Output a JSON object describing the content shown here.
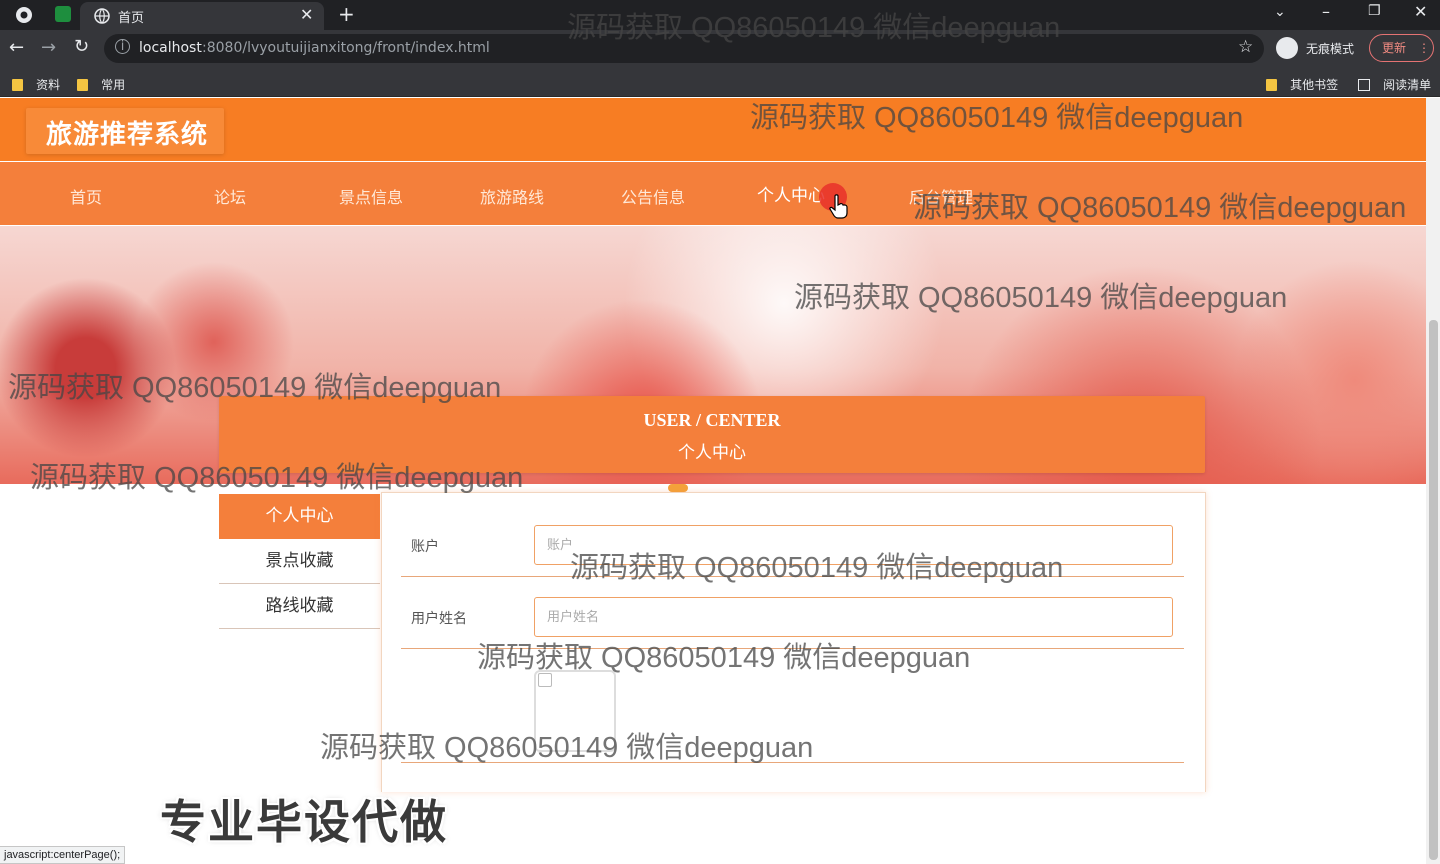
{
  "browser": {
    "tab_title": "首页",
    "url_host": "localhost",
    "url_rest": ":8080/lvyoutuijianxitong/front/index.html",
    "incognito_label": "无痕模式",
    "update_label": "更新",
    "bookmarks": [
      "资料",
      "常用"
    ],
    "bookmarks_right": [
      "其他书签",
      "阅读清单"
    ],
    "status_url": "javascript:centerPage();"
  },
  "site": {
    "title": "旅游推荐系统",
    "nav": [
      "首页",
      "论坛",
      "景点信息",
      "旅游路线",
      "公告信息",
      "个人中心",
      "后台管理"
    ]
  },
  "banner": {
    "active_slide_index": 0,
    "slide_count": 3
  },
  "user_center": {
    "title_en": "USER / CENTER",
    "title_cn": "个人中心",
    "sidebar": [
      "个人中心",
      "景点收藏",
      "路线收藏"
    ],
    "form": {
      "account_label": "账户",
      "account_placeholder": "账户",
      "name_label": "用户姓名",
      "name_placeholder": "用户姓名"
    }
  },
  "watermarks": [
    "源码获取 QQ86050149 微信deepguan",
    "源码获取 QQ86050149 微信deepguan",
    "源码获取 QQ86050149 微信deepguan",
    "源码获取 QQ86050149 微信deepguan",
    "源码获取 QQ86050149 微信deepguan",
    "源码获取 QQ86050149 微信deepguan",
    "源码获取 QQ86050149 微信deepguan",
    "源码获取 QQ86050149 微信deepguan",
    "源码获取 QQ86050149 微信deepguan"
  ],
  "promo_text": "专业毕设代做",
  "colors": {
    "primary": "#f47f3b",
    "header": "#f77d23",
    "chrome_dark": "#202124"
  }
}
